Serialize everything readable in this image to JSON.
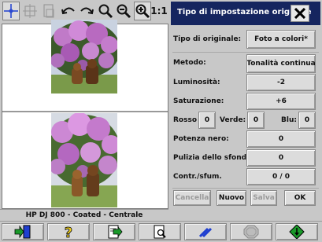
{
  "colors": {
    "title_bar": "#15255f",
    "dialog_bg": "#c8c8c8",
    "button_bg": "#dcdcdc",
    "icon_green": "#1a9a2a",
    "icon_blue": "#1f3fd0",
    "icon_yellow": "#f0d020"
  },
  "toolbar": {
    "icons": [
      "crosshair-icon",
      "move-icon",
      "page-icon",
      "undo-icon",
      "redo-icon",
      "zoom-icon",
      "zoom-out-icon",
      "zoom-in-icon"
    ],
    "zoom_1to1_label": "1:1"
  },
  "status": {
    "text": "HP DJ 800 - Coated - Centrale"
  },
  "dialog": {
    "title": "Tipo di impostazione originale",
    "close_icon": "close-icon",
    "tipo_label": "Tipo di originale:",
    "tipo_value": "Foto a colori*",
    "metodo_label": "Metodo:",
    "metodo_value": "Tonalità continua",
    "luminosita_label": "Luminosità:",
    "luminosita_value": "-2",
    "saturazione_label": "Saturazione:",
    "saturazione_value": "+6",
    "rosso_label": "Rosso",
    "rosso_value": "0",
    "verde_label": "Verde:",
    "verde_value": "0",
    "blu_label": "Blu:",
    "blu_value": "0",
    "potenza_label": "Potenza nero:",
    "potenza_value": "0",
    "pulizia_label": "Pulizia dello sfondo",
    "pulizia_value": "0",
    "contr_label": "Contr./sfum.",
    "contr_value": "0 / 0",
    "cancella_label": "Cancella",
    "nuovo_label": "Nuovo",
    "salva_label": "Salva",
    "ok_label": "OK"
  },
  "bottombar": {
    "icons": [
      "exit-icon",
      "help-icon",
      "setup-icon",
      "print-preview-icon",
      "line-icon",
      "stop-icon",
      "start-icon"
    ]
  }
}
